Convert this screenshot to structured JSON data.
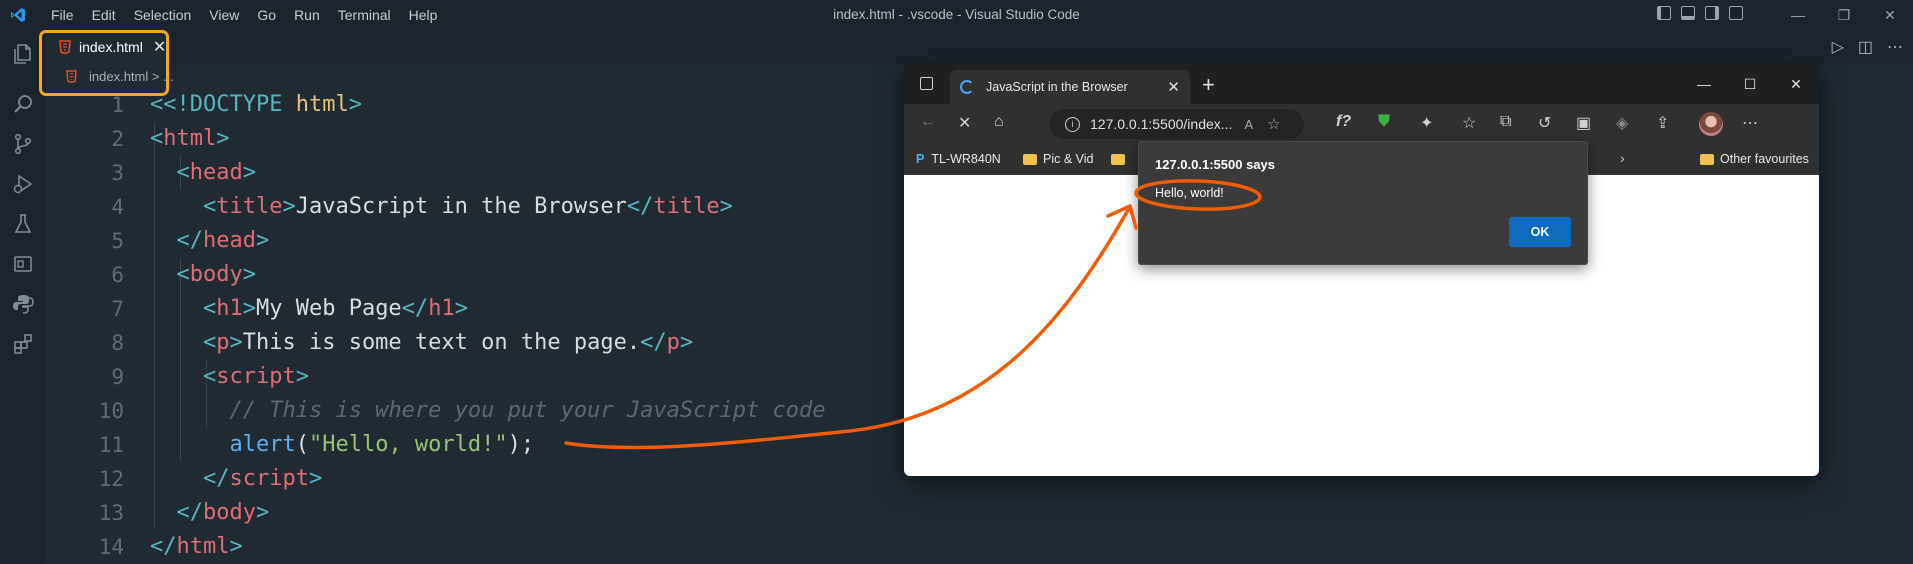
{
  "window": {
    "title": "index.html - .vscode - Visual Studio Code"
  },
  "menu": [
    "File",
    "Edit",
    "Selection",
    "View",
    "Go",
    "Run",
    "Terminal",
    "Help"
  ],
  "editor": {
    "tab_label": "index.html",
    "tab_close": "✕",
    "breadcrumb": "index.html > ...",
    "lines": [
      {
        "n": "1"
      },
      {
        "n": "2"
      },
      {
        "n": "3"
      },
      {
        "n": "4"
      },
      {
        "n": "5"
      },
      {
        "n": "6"
      },
      {
        "n": "7"
      },
      {
        "n": "8"
      },
      {
        "n": "9"
      },
      {
        "n": "10"
      },
      {
        "n": "11"
      },
      {
        "n": "12"
      },
      {
        "n": "13"
      },
      {
        "n": "14"
      }
    ],
    "code": {
      "l1_doctype": "<!DOCTYPE",
      "l1_html": "html",
      "l1_close": ">",
      "l4_text": "JavaScript in the Browser",
      "l7_text": "My Web Page",
      "l8_text": "This is some text on the page.",
      "l10_comment": "// This is where you put your JavaScript code",
      "l11_fn": "alert",
      "l11_str": "\"Hello, world!\"",
      "l11_end": ");",
      "tag_html": "html",
      "tag_head": "head",
      "tag_title": "title",
      "tag_body": "body",
      "tag_h1": "h1",
      "tag_p": "p",
      "tag_script": "script"
    }
  },
  "browser": {
    "tab_title": "JavaScript in the Browser",
    "tab_close": "✕",
    "new_tab": "+",
    "url": "127.0.0.1:5500/index...",
    "favourites": [
      {
        "label": "TL-WR840N"
      },
      {
        "label": "Pic & Vid"
      },
      {
        "label": "Other favourites"
      }
    ]
  },
  "dialog": {
    "title": "127.0.0.1:5500 says",
    "message": "Hello, world!",
    "ok_label": "OK"
  },
  "colors": {
    "highlight_box": "#f5a623",
    "annotation_arrow": "#f25c05",
    "dialog_ok": "#0f6cbd"
  },
  "icons": [
    "vscode-logo",
    "files-icon",
    "search-icon",
    "source-control-icon",
    "run-debug-icon",
    "testing-icon",
    "remote-explorer-icon",
    "python-icon",
    "extensions-icon",
    "html-file-icon"
  ]
}
